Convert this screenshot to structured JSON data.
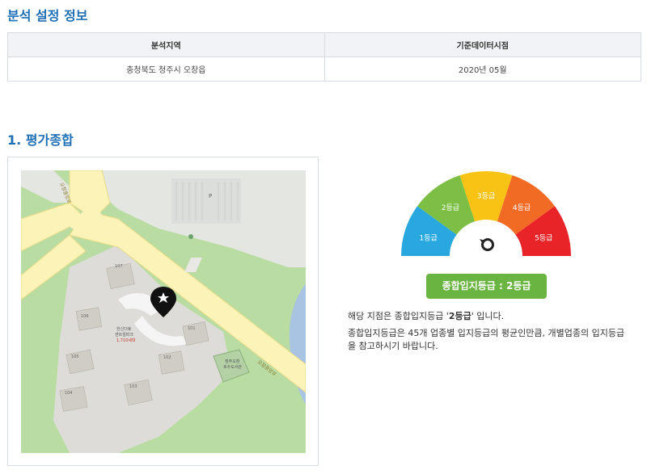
{
  "section1": {
    "title": "분석 설정 정보"
  },
  "info_table": {
    "headers": [
      "분석지역",
      "기준데이터시점"
    ],
    "row": [
      "충청북도 청주시 오창읍",
      "2020년 05월"
    ]
  },
  "section2": {
    "title": "1. 평가종합"
  },
  "map": {
    "road_label_1": "오창중앙로",
    "road_label_2": "오창중앙로",
    "apt_name_1": "한신더휴",
    "apt_name_2": "센트럴파크",
    "apt_units": "1,710세대",
    "library_1": "청주오창",
    "library_2": "호수도서관",
    "parking": "P",
    "buildings": [
      "107",
      "106",
      "105",
      "104",
      "103",
      "102",
      "101",
      "108"
    ]
  },
  "gauge": {
    "grades": [
      "1등급",
      "2등급",
      "3등급",
      "4등급",
      "5등급"
    ],
    "colors": [
      "#29a8e0",
      "#7cbf44",
      "#f8c314",
      "#f26b24",
      "#e92429"
    ],
    "current_grade_index": 1
  },
  "summary": {
    "button_label": "종합입지등급 : 2등급",
    "sentence_prefix": "해당 지점은 종합입지등급 '",
    "sentence_grade": "2등급",
    "sentence_suffix": "' 입니다.",
    "note": "종합입지등급은 45개 업종별 입지등급의 평균인만큼, 개별업종의 입지등급을 참고하시기 바랍니다."
  }
}
